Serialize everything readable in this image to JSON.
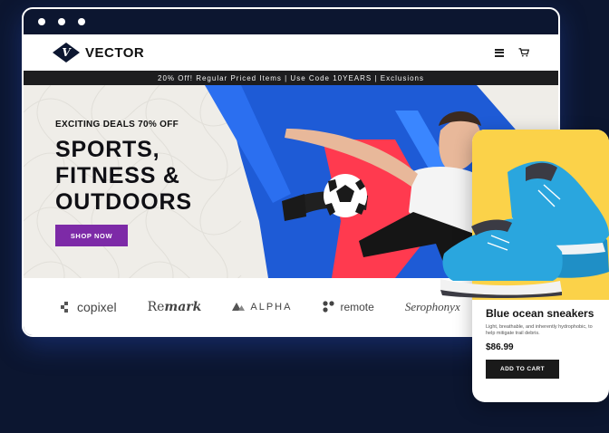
{
  "brand": {
    "logo_letter": "V",
    "name": "VECTOR"
  },
  "nav": {
    "menu_icon": "hamburger-icon",
    "cart_icon": "cart-icon"
  },
  "promo_bar": "20% Off! Regular Priced Items | Use Code 10YEARS | Exclusions",
  "hero": {
    "kicker": "EXCITING DEALS 70% OFF",
    "headline_1": "SPORTS,",
    "headline_2": "FITNESS &",
    "headline_3": "OUTDOORS",
    "cta": "SHOP NOW"
  },
  "partner_logos": [
    {
      "name": "copixel"
    },
    {
      "name_plain": "Re",
      "name_italic": "mark"
    },
    {
      "name": "ALPHA"
    },
    {
      "name": "remote"
    },
    {
      "name": "Serophonyx"
    }
  ],
  "product_card": {
    "title": "Blue ocean sneakers",
    "description": "Light, breathable, and inherently hydrophobic, to help mitigate trail debris.",
    "price": "$86.99",
    "cta": "ADD TO CART"
  },
  "colors": {
    "background": "#0c1630",
    "accent_purple": "#7d2aa7",
    "hero_blue": "#1e5bd6",
    "hero_red": "#ff3a4f",
    "card_yellow": "#fbd249",
    "shoe_blue": "#2aa6de"
  }
}
